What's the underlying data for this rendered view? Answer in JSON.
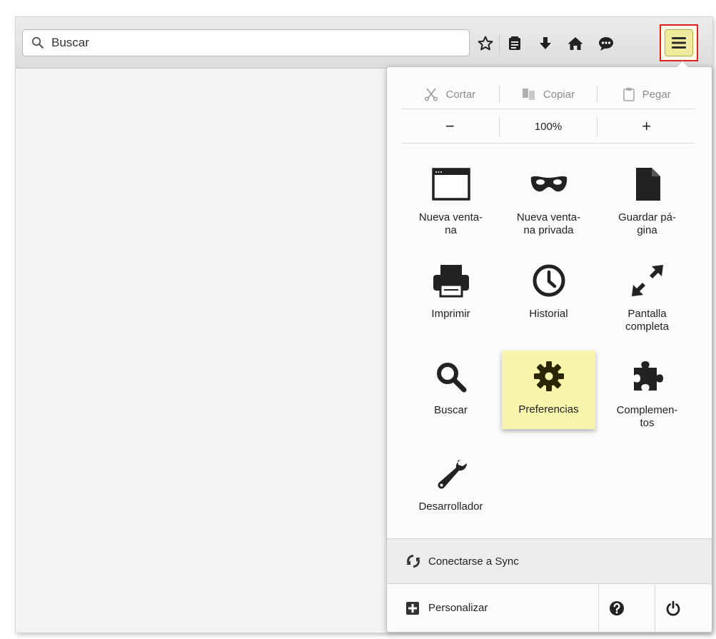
{
  "toolbar": {
    "search": {
      "placeholder": "Buscar",
      "icon": "search-icon"
    },
    "buttons": [
      {
        "name": "bookmark-star",
        "icon": "star-icon"
      },
      {
        "name": "reading-list",
        "icon": "clipboard-icon"
      },
      {
        "name": "downloads",
        "icon": "download-arrow-icon"
      },
      {
        "name": "home",
        "icon": "home-icon"
      },
      {
        "name": "chat",
        "icon": "chat-bubble-icon"
      }
    ],
    "menu_button": {
      "icon": "hamburger-menu-icon",
      "highlight_color": "#e0201c"
    }
  },
  "panel": {
    "edit": {
      "cut": "Cortar",
      "copy": "Copiar",
      "paste": "Pegar"
    },
    "zoom": {
      "minus": "−",
      "level": "100%",
      "plus": "+"
    },
    "tiles": [
      {
        "id": "new-window",
        "label": "Nueva venta-\nna",
        "icon": "window-icon"
      },
      {
        "id": "private-window",
        "label": "Nueva venta-\nna privada",
        "icon": "mask-icon"
      },
      {
        "id": "save-page",
        "label": "Guardar pá-\ngina",
        "icon": "document-icon"
      },
      {
        "id": "print",
        "label": "Imprimir",
        "icon": "printer-icon"
      },
      {
        "id": "history",
        "label": "Historial",
        "icon": "clock-icon"
      },
      {
        "id": "fullscreen",
        "label": "Pantalla\ncompleta",
        "icon": "expand-arrows-icon"
      },
      {
        "id": "find",
        "label": "Buscar",
        "icon": "magnifier-icon"
      },
      {
        "id": "preferences",
        "label": "Preferencias",
        "icon": "gear-icon",
        "highlighted": true,
        "highlight_color": "#f8f6ad"
      },
      {
        "id": "addons",
        "label": "Complemen-\ntos",
        "icon": "puzzle-icon"
      },
      {
        "id": "developer",
        "label": "Desarrollador",
        "icon": "wrench-icon"
      }
    ],
    "sync": {
      "label": "Conectarse a Sync",
      "icon": "sync-icon"
    },
    "footer": {
      "customize": "Personalizar",
      "customize_icon": "plus-square-icon",
      "help_icon": "help-icon",
      "quit_icon": "power-icon"
    }
  }
}
